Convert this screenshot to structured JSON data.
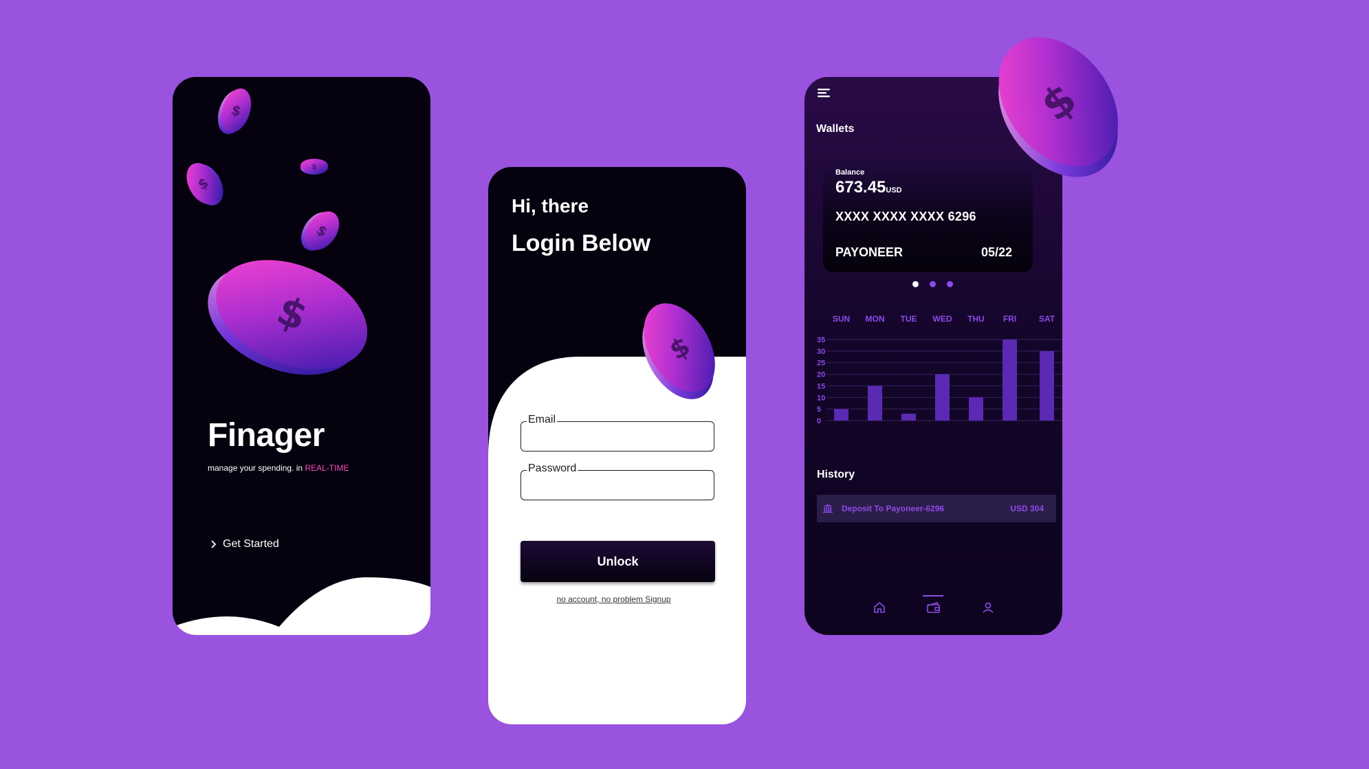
{
  "splash": {
    "app_name": "Finager",
    "tagline_main": "manage your spending. in ",
    "tagline_accent": "REAL-TIME",
    "cta_label": "Get Started"
  },
  "login": {
    "greeting": "Hi, there",
    "heading": "Login Below",
    "email_label": "Email",
    "password_label": "Password",
    "unlock_label": "Unlock",
    "signup_link": "no account, no problem Signup"
  },
  "dashboard": {
    "section_wallets": "Wallets",
    "card": {
      "balance_label": "Balance",
      "balance_value": "673.45",
      "balance_currency": "USD",
      "card_number": "XXXX XXXX XXXX 6296",
      "bank": "PAYONEER",
      "expiry": "05/22"
    },
    "section_history": "History",
    "transaction": {
      "description": "Deposit To Payoneer-6296",
      "amount": "USD  304"
    }
  },
  "colors": {
    "background": "#9953df",
    "accent": "#8b4de6",
    "pink": "#ff4fbd",
    "dark": "#05010e"
  },
  "chart_data": {
    "type": "bar",
    "categories": [
      "SUN",
      "MON",
      "TUE",
      "WED",
      "THU",
      "FRI",
      "SAT"
    ],
    "values": [
      5,
      15,
      3,
      20,
      10,
      35,
      30
    ],
    "yticks": [
      0,
      5,
      10,
      15,
      20,
      25,
      30,
      35
    ],
    "ylim": [
      0,
      35
    ],
    "grid": true,
    "bar_color": "#5a2ab3",
    "label_color": "#8c4ae6"
  }
}
